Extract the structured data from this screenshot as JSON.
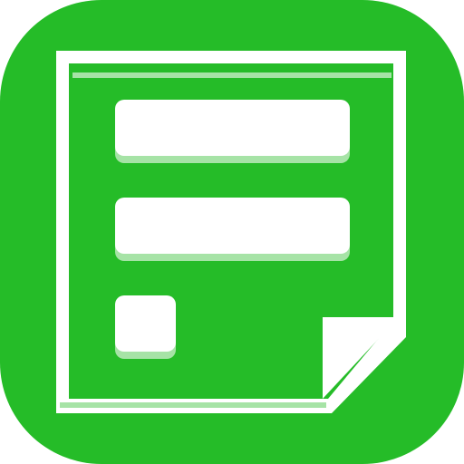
{
  "icon": {
    "name": "note-form-icon",
    "colors": {
      "background": "#25BC28",
      "foreground": "#FFFFFF",
      "shadow": "#A6E3A6"
    }
  }
}
